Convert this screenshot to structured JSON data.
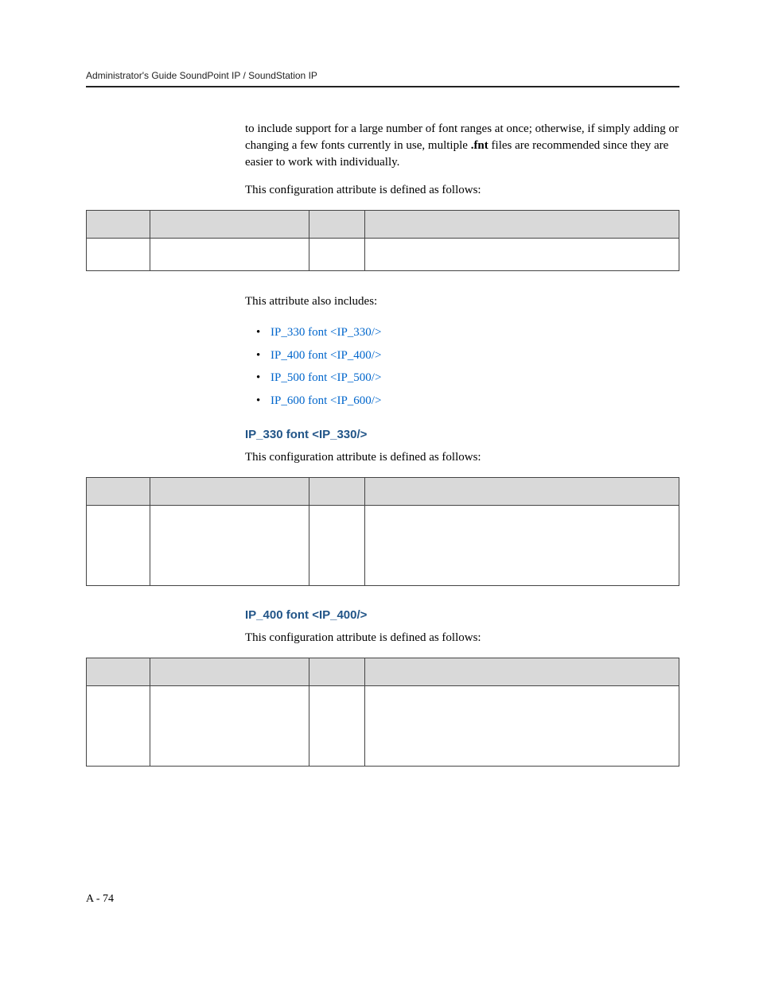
{
  "header": {
    "running_title": "Administrator's Guide SoundPoint IP / SoundStation IP"
  },
  "intro": {
    "para1_pre": "to include support for a large number of font ranges at once; otherwise, if simply adding or changing a few fonts currently in use, multiple ",
    "para1_bold": ".fnt",
    "para1_post": " files are recommended since they are easier to work with individually.",
    "para2": "This configuration attribute is defined as follows:",
    "also_includes": "This attribute also includes:"
  },
  "bullets": [
    "IP_330 font <IP_330/>",
    "IP_400 font <IP_400/>",
    "IP_500 font <IP_500/>",
    "IP_600 font <IP_600/>"
  ],
  "section_330": {
    "heading": "IP_330 font <IP_330/>",
    "para": "This configuration attribute is defined as follows:"
  },
  "section_400": {
    "heading": "IP_400 font <IP_400/>",
    "para": "This configuration attribute is defined as follows:"
  },
  "footer": {
    "page_number": "A - 74"
  }
}
